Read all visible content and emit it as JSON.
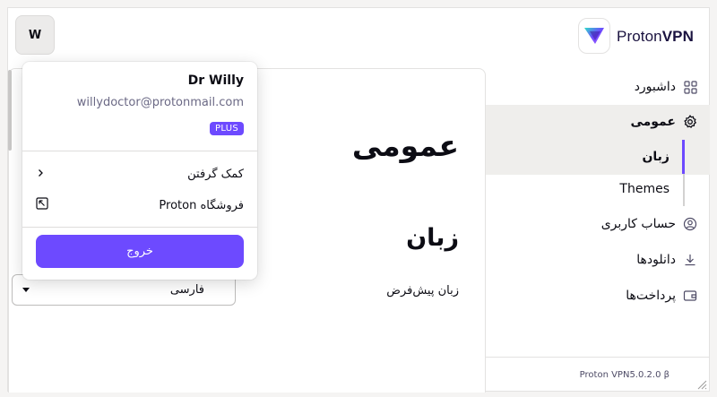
{
  "account": {
    "avatar_initial": "W",
    "name": "Dr Willy",
    "email": "willydoctor@protonmail.com",
    "plan_badge": "PLUS"
  },
  "brand": {
    "logo_text_a": "Proton",
    "logo_text_b": "VPN",
    "accent_color": "#6d4aff"
  },
  "popup_menu": {
    "items": [
      {
        "label": "کمک گرفتن",
        "icon": "chevron-left-icon"
      },
      {
        "label": "فروشگاه Proton",
        "icon": "external-link-icon"
      }
    ],
    "logout_label": "خروج"
  },
  "main": {
    "page_title": "عمومی",
    "section_title": "زبان",
    "default_language_label": "زبان پیش‌فرض",
    "language_value": "فارسی"
  },
  "sidebar": {
    "items": [
      {
        "label": "داشبورد",
        "icon": "grid-icon"
      },
      {
        "label": "عمومی",
        "icon": "gear-icon"
      },
      {
        "label": "حساب کاربری",
        "icon": "user-circle-icon"
      },
      {
        "label": "دانلودها",
        "icon": "download-icon"
      },
      {
        "label": "پرداخت‌ها",
        "icon": "wallet-icon"
      }
    ],
    "sub_items": [
      {
        "label": "زبان"
      },
      {
        "label": "Themes"
      }
    ],
    "version": "Proton VPN5.0.2.0 β"
  }
}
